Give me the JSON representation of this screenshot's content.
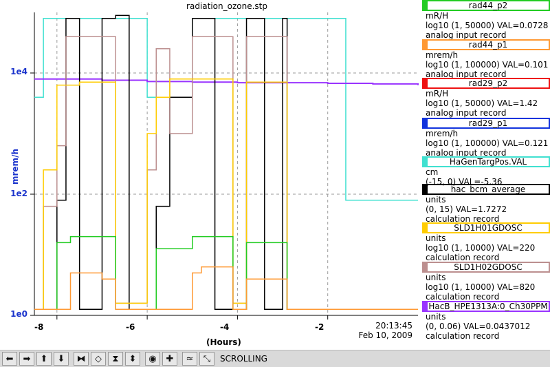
{
  "chart_data": {
    "type": "line",
    "title": "radiation_ozone.stp",
    "xlabel": "(Hours)",
    "ylabel": "mrem/h",
    "ylim_log10": [
      0,
      5
    ],
    "xlim": [
      -8.5,
      0
    ],
    "y_ticks": [
      "1e4",
      "1e2",
      "1e0"
    ],
    "x_ticks": [
      "-8",
      "-6",
      "-4",
      "-2"
    ],
    "timestamp": "20:13:45",
    "date": "Feb 10, 2009",
    "series": [
      {
        "name": "HaGenTargPos.VAL",
        "color": "#40e0d0",
        "x": [
          -8.5,
          -8.3,
          -8.3,
          -6.0,
          -6.0,
          -5.0,
          -5.0,
          -1.6,
          -1.6,
          0.0
        ],
        "y": [
          3.6,
          3.6,
          4.9,
          4.9,
          3.6,
          3.6,
          4.9,
          4.9,
          1.9,
          1.9
        ]
      },
      {
        "name": "HacB_HPE1313A:0_Ch30PPM",
        "color": "#9933ff",
        "x": [
          -8.5,
          -7,
          -6,
          -5,
          -4,
          -3,
          -2,
          -1,
          0
        ],
        "y": [
          3.9,
          3.88,
          3.86,
          3.85,
          3.84,
          3.84,
          3.83,
          3.82,
          3.8
        ]
      },
      {
        "name": "hac_bcm_average",
        "color": "#000000",
        "x": [
          -8.5,
          -8.3,
          -8.0,
          -7.8,
          -7.5,
          -7.0,
          -6.7,
          -6.4,
          -6.0,
          -5.8,
          -5.5,
          -5.0,
          -4.5,
          -4.1,
          -3.8,
          -3.4,
          -3.0,
          -2.9,
          -2.5,
          0.0
        ],
        "y": [
          0.1,
          0.1,
          1.9,
          4.9,
          0.1,
          4.9,
          4.95,
          0.1,
          0.1,
          1.8,
          3.6,
          4.9,
          0.1,
          0.1,
          4.9,
          0.1,
          4.9,
          0.1,
          0.1,
          0.1
        ]
      },
      {
        "name": "SLD1H02GDOSC",
        "color": "#bc8f8f",
        "x": [
          -8.5,
          -8.3,
          -8.0,
          -7.8,
          -7.0,
          -6.7,
          -6.0,
          -5.8,
          -5.5,
          -5.0,
          -4.1,
          -3.8,
          -3.0,
          -2.9,
          0.0
        ],
        "y": [
          0.1,
          1.8,
          2.8,
          4.6,
          4.6,
          0.2,
          2.4,
          4.4,
          3.0,
          4.6,
          0.2,
          4.6,
          4.6,
          0.1,
          0.1
        ]
      },
      {
        "name": "SLD1H01GDOSC",
        "color": "#ffcc00",
        "x": [
          -8.5,
          -8.3,
          -8.0,
          -7.5,
          -7.0,
          -6.7,
          -6.0,
          -5.8,
          -5.5,
          -5.0,
          -4.1,
          -3.8,
          -3.0,
          -2.9,
          0.0
        ],
        "y": [
          0.1,
          2.4,
          3.8,
          3.85,
          3.85,
          0.2,
          3.0,
          3.6,
          3.9,
          3.9,
          0.2,
          3.85,
          3.85,
          0.1,
          0.1
        ]
      },
      {
        "name": "rad44_p2",
        "color": "#22cc22",
        "x": [
          -8.5,
          -8.3,
          -8.0,
          -7.7,
          -7.0,
          -6.7,
          -6.0,
          -5.8,
          -5.0,
          -4.8,
          -4.1,
          -3.8,
          -3.0,
          -2.9,
          0.0
        ],
        "y": [
          0.1,
          0.1,
          1.2,
          1.3,
          1.3,
          0.1,
          0.1,
          1.1,
          1.3,
          1.3,
          0.1,
          1.2,
          1.2,
          0.1,
          0.1
        ]
      },
      {
        "name": "rad44_p1",
        "color": "#ff9933",
        "x": [
          -8.5,
          -8.0,
          -7.7,
          -7.0,
          -6.7,
          -6.0,
          -5.0,
          -4.8,
          -4.1,
          -3.8,
          -3.0,
          -2.9,
          0.0
        ],
        "y": [
          0.1,
          0.1,
          0.7,
          0.6,
          0.1,
          0.1,
          0.7,
          0.8,
          0.1,
          0.6,
          0.6,
          0.1,
          0.1
        ]
      }
    ]
  },
  "legend": [
    {
      "name": "rad44_p2",
      "color": "#22cc22",
      "lines": [
        "mR/H",
        "log10 (1, 50000) VAL=0.0728",
        "analog input record"
      ]
    },
    {
      "name": "rad44_p1",
      "color": "#ff9933",
      "lines": [
        "mrem/h",
        "log10 (1, 100000) VAL=0.101",
        "analog input record"
      ]
    },
    {
      "name": "rad29_p2",
      "color": "#ee1111",
      "lines": [
        "mR/H",
        "log10 (1, 50000) VAL=1.42",
        "analog input record"
      ]
    },
    {
      "name": "rad29_p1",
      "color": "#1133dd",
      "lines": [
        "mrem/h",
        "log10 (1, 100000) VAL=0.121",
        "analog input record"
      ]
    },
    {
      "name": "HaGenTargPos.VAL",
      "color": "#40e0d0",
      "lines": [
        "cm",
        "(-15, 0) VAL=-5.36"
      ]
    },
    {
      "name": "hac_bcm_average",
      "color": "#000000",
      "lines": [
        "units",
        "(0, 15) VAL=1.7272",
        "calculation record"
      ]
    },
    {
      "name": "SLD1H01GDOSC",
      "color": "#ffcc00",
      "lines": [
        "units",
        "log10 (1, 10000) VAL=220",
        "calculation record"
      ]
    },
    {
      "name": "SLD1H02GDOSC",
      "color": "#bc8f8f",
      "lines": [
        "units",
        "log10 (1, 10000) VAL=820",
        "calculation record"
      ]
    },
    {
      "name": "HacB_HPE1313A:0_Ch30PPM",
      "color": "#9933ff",
      "lines": [
        "units",
        "(0, 0.06) VAL=0.0437012",
        "calculation record"
      ]
    }
  ],
  "toolbar": {
    "buttons": [
      {
        "icon": "arrow-left-icon",
        "glyph": "⬅"
      },
      {
        "icon": "arrow-right-icon",
        "glyph": "➡"
      },
      {
        "icon": "arrow-up-icon",
        "glyph": "⬆"
      },
      {
        "icon": "arrow-down-icon",
        "glyph": "⬇"
      },
      {
        "icon": "zoom-in-horizontal-icon",
        "glyph": "⧓"
      },
      {
        "icon": "zoom-out-horizontal-icon",
        "glyph": "◇"
      },
      {
        "icon": "zoom-in-vertical-icon",
        "glyph": "⧗"
      },
      {
        "icon": "zoom-out-vertical-icon",
        "glyph": "⬍"
      },
      {
        "icon": "record-icon",
        "glyph": "◉"
      },
      {
        "icon": "add-icon",
        "glyph": "✚"
      },
      {
        "icon": "autoscale-icon",
        "glyph": "≈"
      },
      {
        "icon": "fit-icon",
        "glyph": "⤡"
      }
    ],
    "mode_label": "SCROLLING"
  }
}
